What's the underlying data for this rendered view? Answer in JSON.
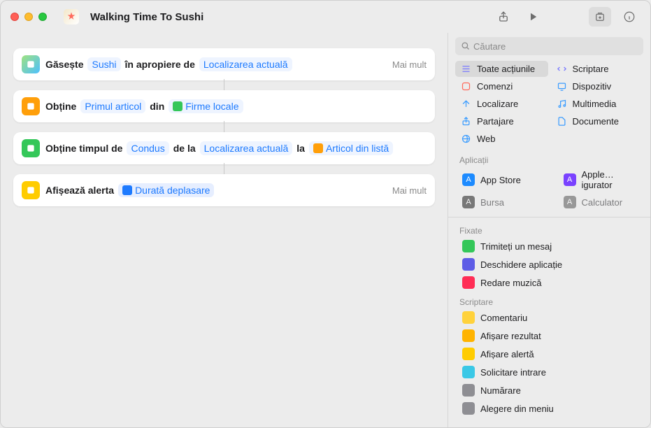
{
  "title": "Walking Time To Sushi",
  "more_label": "Mai mult",
  "search_placeholder": "Căutare",
  "actions": [
    {
      "icon_bg": "linear-gradient(135deg,#9fe27f,#4dc0ff)",
      "parts": [
        {
          "t": "text",
          "v": "Găsește"
        },
        {
          "t": "pill",
          "v": "Sushi"
        },
        {
          "t": "text",
          "v": "în apropiere de"
        },
        {
          "t": "pill",
          "v": "Localizarea actuală"
        }
      ],
      "more": true
    },
    {
      "icon_bg": "#ff9f0a",
      "parts": [
        {
          "t": "text",
          "v": "Obține"
        },
        {
          "t": "pill",
          "v": "Primul articol"
        },
        {
          "t": "text",
          "v": "din"
        },
        {
          "t": "pill",
          "v": "Firme locale",
          "chip": true
        }
      ],
      "more": false
    },
    {
      "icon_bg": "#34c759",
      "parts": [
        {
          "t": "text",
          "v": "Obține timpul de"
        },
        {
          "t": "pill",
          "v": "Condus"
        },
        {
          "t": "text",
          "v": "de la"
        },
        {
          "t": "pill",
          "v": "Localizarea actuală"
        },
        {
          "t": "text",
          "v": "la"
        },
        {
          "t": "pill",
          "v": "Articol din listă",
          "chip": true,
          "chipbg": "#ff9f0a"
        }
      ],
      "more": false
    },
    {
      "icon_bg": "#ffcc00",
      "parts": [
        {
          "t": "text",
          "v": "Afișează alerta"
        },
        {
          "t": "pill",
          "v": "Durată deplasare",
          "chip": true,
          "chipbg": "#1d7aff",
          "bg": "#e6eeff"
        }
      ],
      "more": true
    }
  ],
  "categories": [
    {
      "label": "Toate acțiunile",
      "color": "#7a7aff",
      "selected": true
    },
    {
      "label": "Scriptare",
      "color": "#7a7aff"
    },
    {
      "label": "Comenzi",
      "color": "#ff6a5c"
    },
    {
      "label": "Dispozitiv",
      "color": "#3c9dff"
    },
    {
      "label": "Localizare",
      "color": "#3c9dff"
    },
    {
      "label": "Multimedia",
      "color": "#3c9dff"
    },
    {
      "label": "Partajare",
      "color": "#3c9dff"
    },
    {
      "label": "Documente",
      "color": "#3c9dff"
    },
    {
      "label": "Web",
      "color": "#3c9dff"
    }
  ],
  "section_apps_label": "Aplicații",
  "apps": [
    {
      "label": "App Store",
      "bg": "#1d8bff"
    },
    {
      "label": "Apple…igurator",
      "bg": "#7a42ff"
    },
    {
      "label": "Bursa",
      "bg": "#1b1b1b",
      "faded": true
    },
    {
      "label": "Calculator",
      "bg": "#555",
      "faded": true
    }
  ],
  "section_pinned_label": "Fixate",
  "pinned": [
    {
      "label": "Trimiteți un mesaj",
      "bg": "#34c759"
    },
    {
      "label": "Deschidere aplicație",
      "bg": "#5e5ce6"
    },
    {
      "label": "Redare muzică",
      "bg": "#ff2d55"
    }
  ],
  "section_scripting_label": "Scriptare",
  "scripting": [
    {
      "label": "Comentariu",
      "bg": "#ffd23c"
    },
    {
      "label": "Afișare rezultat",
      "bg": "#ffb300"
    },
    {
      "label": "Afișare alertă",
      "bg": "#ffcc00"
    },
    {
      "label": "Solicitare intrare",
      "bg": "#3ac8e6"
    },
    {
      "label": "Numărare",
      "bg": "#8e8e93"
    },
    {
      "label": "Alegere din meniu",
      "bg": "#8e8e93"
    }
  ]
}
